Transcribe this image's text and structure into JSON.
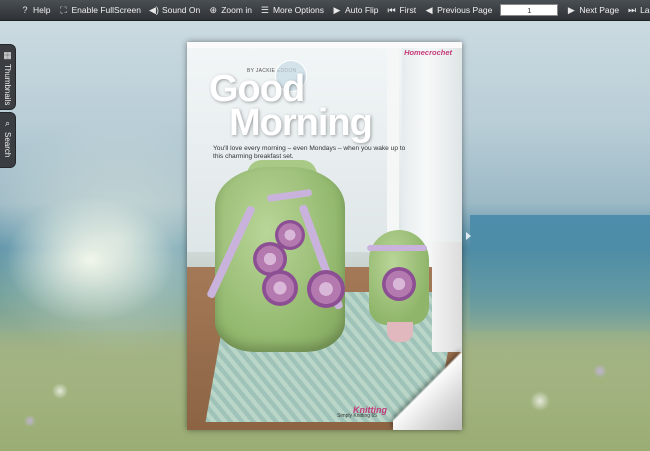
{
  "toolbar": {
    "help": "Help",
    "fullscreen": "Enable FullScreen",
    "sound": "Sound On",
    "zoom": "Zoom in",
    "more": "More Options",
    "autoflip": "Auto Flip",
    "first": "First",
    "previous": "Previous Page",
    "page_value": "1",
    "next": "Next Page",
    "last": "Last"
  },
  "sidebar": {
    "thumbnails": "Thumbnails",
    "search": "Search"
  },
  "page": {
    "byline": "BY JACKIE EDDON",
    "brand": "Homecrochet",
    "title_line1": "Good",
    "title_line2": "Morning",
    "subtitle": "You'll love every morning – even Mondays – when you wake up to this charming breakfast set.",
    "footer": "Simply Knitting 65",
    "footer_logo": "Knitting"
  },
  "icons": {
    "help": "help-icon",
    "fullscreen": "fullscreen-icon",
    "sound": "speaker-icon",
    "zoom": "zoom-icon",
    "more": "menu-icon",
    "autoflip": "play-icon",
    "first": "first-page-icon",
    "previous": "previous-icon",
    "next": "next-icon",
    "last": "last-page-icon",
    "thumbnails": "grid-icon",
    "search": "search-icon"
  }
}
